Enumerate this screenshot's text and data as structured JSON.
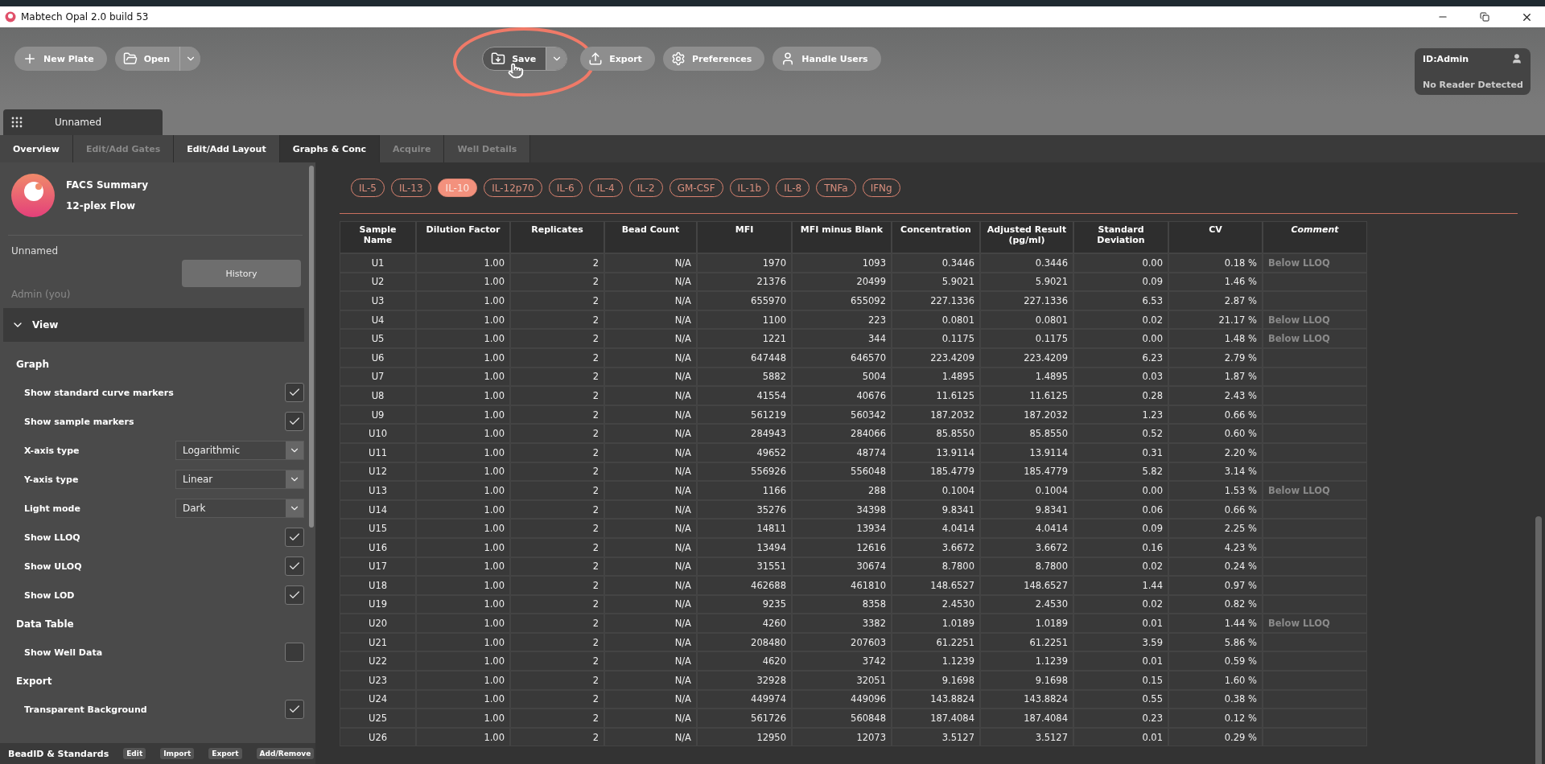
{
  "window": {
    "title": "Mabtech Opal 2.0 build 53"
  },
  "toolbar": {
    "buttons": [
      {
        "label": "New Plate",
        "kind": "plus",
        "split": false,
        "highlighted": false
      },
      {
        "label": "Open",
        "kind": "folder",
        "split": true,
        "highlighted": false
      },
      {
        "label": "Save",
        "kind": "save",
        "split": true,
        "highlighted": true
      },
      {
        "label": "Export",
        "kind": "upload",
        "split": false,
        "highlighted": false
      },
      {
        "label": "Preferences",
        "kind": "gear",
        "split": false,
        "highlighted": false
      },
      {
        "label": "Handle Users",
        "kind": "user",
        "split": false,
        "highlighted": false
      }
    ]
  },
  "id_panel": {
    "id": "ID:Admin",
    "reader": "No Reader Detected"
  },
  "document_tab": {
    "label": "Unnamed"
  },
  "tabs": [
    {
      "label": "Overview",
      "selected": false,
      "disabled": false
    },
    {
      "label": "Edit/Add Gates",
      "selected": false,
      "disabled": true
    },
    {
      "label": "Edit/Add Layout",
      "selected": false,
      "disabled": false
    },
    {
      "label": "Graphs & Conc",
      "selected": true,
      "disabled": false
    },
    {
      "label": "Acquire",
      "selected": false,
      "disabled": true
    },
    {
      "label": "Well Details",
      "selected": false,
      "disabled": true
    }
  ],
  "sidebar": {
    "title": "FACS Summary",
    "subtitle": "12-plex Flow",
    "name": "Unnamed",
    "history_button": "History",
    "user": "Admin (you)",
    "view_section": {
      "label": "View",
      "expanded": true
    },
    "groups": [
      {
        "heading": "Graph",
        "items": [
          {
            "label": "Show standard curve markers",
            "kind": "checkbox",
            "checked": true
          },
          {
            "label": "Show sample markers",
            "kind": "checkbox",
            "checked": true
          },
          {
            "label": "X-axis type",
            "kind": "select",
            "value": "Logarithmic"
          },
          {
            "label": "Y-axis type",
            "kind": "select",
            "value": "Linear"
          },
          {
            "label": "Light mode",
            "kind": "select",
            "value": "Dark"
          },
          {
            "label": "Show LLOQ",
            "kind": "checkbox",
            "checked": true
          },
          {
            "label": "Show ULOQ",
            "kind": "checkbox",
            "checked": true
          },
          {
            "label": "Show LOD",
            "kind": "checkbox",
            "checked": true
          }
        ]
      },
      {
        "heading": "Data Table",
        "items": [
          {
            "label": "Show Well Data",
            "kind": "checkbox",
            "checked": false
          }
        ]
      },
      {
        "heading": "Export",
        "items": [
          {
            "label": "Transparent Background",
            "kind": "checkbox",
            "checked": true
          }
        ]
      }
    ],
    "footer": {
      "label": "BeadID & Standards",
      "actions": [
        "Edit",
        "Import",
        "Export",
        "Add/Remove"
      ]
    }
  },
  "analytes": [
    {
      "label": "IL-5",
      "selected": false
    },
    {
      "label": "IL-13",
      "selected": false
    },
    {
      "label": "IL-10",
      "selected": true
    },
    {
      "label": "IL-12p70",
      "selected": false
    },
    {
      "label": "IL-6",
      "selected": false
    },
    {
      "label": "IL-4",
      "selected": false
    },
    {
      "label": "IL-2",
      "selected": false
    },
    {
      "label": "GM-CSF",
      "selected": false
    },
    {
      "label": "IL-1b",
      "selected": false
    },
    {
      "label": "IL-8",
      "selected": false
    },
    {
      "label": "TNFa",
      "selected": false
    },
    {
      "label": "IFNg",
      "selected": false
    }
  ],
  "table": {
    "columns": [
      "Sample Name",
      "Dilution Factor",
      "Replicates",
      "Bead Count",
      "MFI",
      "MFI minus Blank",
      "Concentration",
      "Adjusted Result (pg/ml)",
      "Standard Deviation",
      "CV",
      "Comment"
    ],
    "rows": [
      [
        "U1",
        "1.00",
        "2",
        "N/A",
        "1970",
        "1093",
        "0.3446",
        "0.3446",
        "0.00",
        "0.18 %",
        "Below LLOQ"
      ],
      [
        "U2",
        "1.00",
        "2",
        "N/A",
        "21376",
        "20499",
        "5.9021",
        "5.9021",
        "0.09",
        "1.46 %",
        ""
      ],
      [
        "U3",
        "1.00",
        "2",
        "N/A",
        "655970",
        "655092",
        "227.1336",
        "227.1336",
        "6.53",
        "2.87 %",
        ""
      ],
      [
        "U4",
        "1.00",
        "2",
        "N/A",
        "1100",
        "223",
        "0.0801",
        "0.0801",
        "0.02",
        "21.17 %",
        "Below LLOQ"
      ],
      [
        "U5",
        "1.00",
        "2",
        "N/A",
        "1221",
        "344",
        "0.1175",
        "0.1175",
        "0.00",
        "1.48 %",
        "Below LLOQ"
      ],
      [
        "U6",
        "1.00",
        "2",
        "N/A",
        "647448",
        "646570",
        "223.4209",
        "223.4209",
        "6.23",
        "2.79 %",
        ""
      ],
      [
        "U7",
        "1.00",
        "2",
        "N/A",
        "5882",
        "5004",
        "1.4895",
        "1.4895",
        "0.03",
        "1.87 %",
        ""
      ],
      [
        "U8",
        "1.00",
        "2",
        "N/A",
        "41554",
        "40676",
        "11.6125",
        "11.6125",
        "0.28",
        "2.43 %",
        ""
      ],
      [
        "U9",
        "1.00",
        "2",
        "N/A",
        "561219",
        "560342",
        "187.2032",
        "187.2032",
        "1.23",
        "0.66 %",
        ""
      ],
      [
        "U10",
        "1.00",
        "2",
        "N/A",
        "284943",
        "284066",
        "85.8550",
        "85.8550",
        "0.52",
        "0.60 %",
        ""
      ],
      [
        "U11",
        "1.00",
        "2",
        "N/A",
        "49652",
        "48774",
        "13.9114",
        "13.9114",
        "0.31",
        "2.20 %",
        ""
      ],
      [
        "U12",
        "1.00",
        "2",
        "N/A",
        "556926",
        "556048",
        "185.4779",
        "185.4779",
        "5.82",
        "3.14 %",
        ""
      ],
      [
        "U13",
        "1.00",
        "2",
        "N/A",
        "1166",
        "288",
        "0.1004",
        "0.1004",
        "0.00",
        "1.53 %",
        "Below LLOQ"
      ],
      [
        "U14",
        "1.00",
        "2",
        "N/A",
        "35276",
        "34398",
        "9.8341",
        "9.8341",
        "0.06",
        "0.66 %",
        ""
      ],
      [
        "U15",
        "1.00",
        "2",
        "N/A",
        "14811",
        "13934",
        "4.0414",
        "4.0414",
        "0.09",
        "2.25 %",
        ""
      ],
      [
        "U16",
        "1.00",
        "2",
        "N/A",
        "13494",
        "12616",
        "3.6672",
        "3.6672",
        "0.16",
        "4.23 %",
        ""
      ],
      [
        "U17",
        "1.00",
        "2",
        "N/A",
        "31551",
        "30674",
        "8.7800",
        "8.7800",
        "0.02",
        "0.24 %",
        ""
      ],
      [
        "U18",
        "1.00",
        "2",
        "N/A",
        "462688",
        "461810",
        "148.6527",
        "148.6527",
        "1.44",
        "0.97 %",
        ""
      ],
      [
        "U19",
        "1.00",
        "2",
        "N/A",
        "9235",
        "8358",
        "2.4530",
        "2.4530",
        "0.02",
        "0.82 %",
        ""
      ],
      [
        "U20",
        "1.00",
        "2",
        "N/A",
        "4260",
        "3382",
        "1.0189",
        "1.0189",
        "0.01",
        "1.44 %",
        "Below LLOQ"
      ],
      [
        "U21",
        "1.00",
        "2",
        "N/A",
        "208480",
        "207603",
        "61.2251",
        "61.2251",
        "3.59",
        "5.86 %",
        ""
      ],
      [
        "U22",
        "1.00",
        "2",
        "N/A",
        "4620",
        "3742",
        "1.1239",
        "1.1239",
        "0.01",
        "0.59 %",
        ""
      ],
      [
        "U23",
        "1.00",
        "2",
        "N/A",
        "32928",
        "32051",
        "9.1698",
        "9.1698",
        "0.15",
        "1.60 %",
        ""
      ],
      [
        "U24",
        "1.00",
        "2",
        "N/A",
        "449974",
        "449096",
        "143.8824",
        "143.8824",
        "0.55",
        "0.38 %",
        ""
      ],
      [
        "U25",
        "1.00",
        "2",
        "N/A",
        "561726",
        "560848",
        "187.4084",
        "187.4084",
        "0.23",
        "0.12 %",
        ""
      ],
      [
        "U26",
        "1.00",
        "2",
        "N/A",
        "12950",
        "12073",
        "3.5127",
        "3.5127",
        "0.01",
        "0.29 %",
        ""
      ]
    ]
  }
}
